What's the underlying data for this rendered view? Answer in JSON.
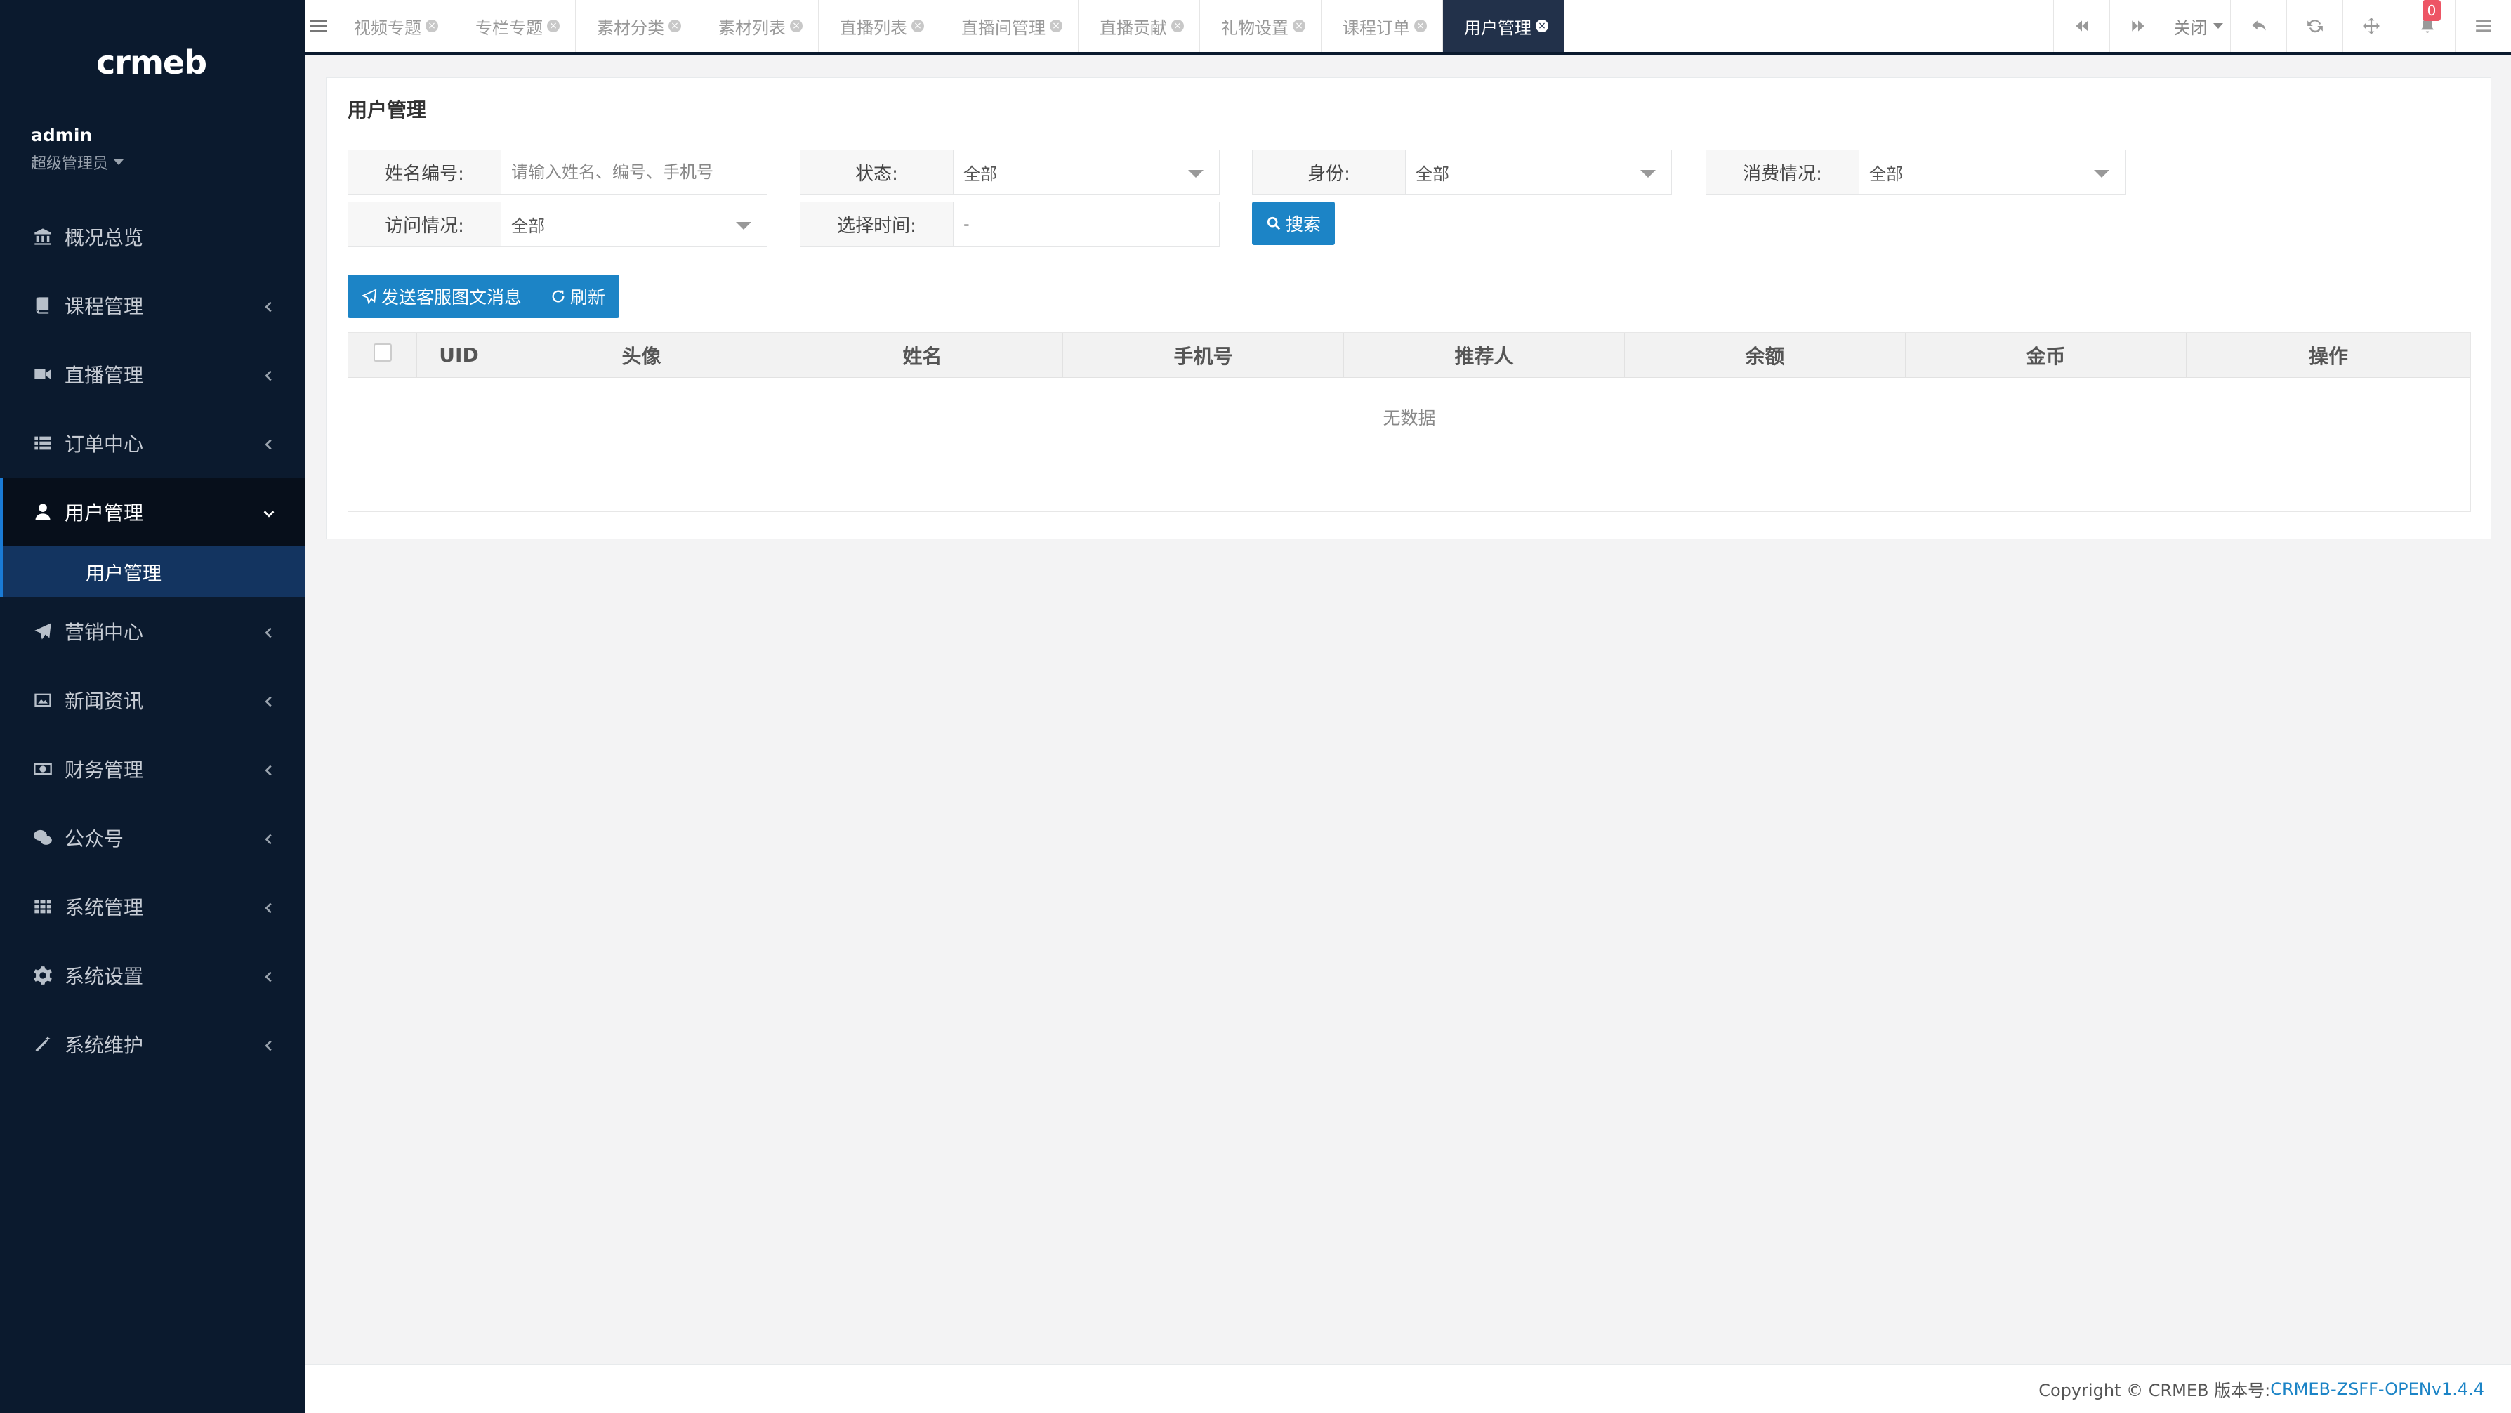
{
  "sidebar": {
    "logo": "crmeb",
    "user": {
      "name": "admin",
      "role": "超级管理员"
    },
    "items": [
      {
        "label": "概况总览",
        "icon": "bank-icon"
      },
      {
        "label": "课程管理",
        "icon": "book-icon"
      },
      {
        "label": "直播管理",
        "icon": "video-camera-icon"
      },
      {
        "label": "订单中心",
        "icon": "list-icon"
      },
      {
        "label": "用户管理",
        "icon": "user-icon",
        "active": true,
        "children": [
          {
            "label": "用户管理"
          }
        ]
      },
      {
        "label": "营销中心",
        "icon": "paper-plane-icon"
      },
      {
        "label": "新闻资讯",
        "icon": "image-icon"
      },
      {
        "label": "财务管理",
        "icon": "money-icon"
      },
      {
        "label": "公众号",
        "icon": "wechat-icon"
      },
      {
        "label": "系统管理",
        "icon": "grid-icon"
      },
      {
        "label": "系统设置",
        "icon": "gear-icon"
      },
      {
        "label": "系统维护",
        "icon": "magic-wand-icon"
      }
    ]
  },
  "topbar": {
    "tabs": [
      {
        "label": "视频专题"
      },
      {
        "label": "专栏专题"
      },
      {
        "label": "素材分类"
      },
      {
        "label": "素材列表"
      },
      {
        "label": "直播列表"
      },
      {
        "label": "直播间管理"
      },
      {
        "label": "直播贡献"
      },
      {
        "label": "礼物设置"
      },
      {
        "label": "课程订单"
      },
      {
        "label": "用户管理",
        "active": true
      }
    ],
    "close_label": "关闭",
    "notification_count": "0"
  },
  "main": {
    "title": "用户管理",
    "filters": {
      "name_label": "姓名编号:",
      "name_placeholder": "请输入姓名、编号、手机号",
      "status_label": "状态:",
      "status_value": "全部",
      "identity_label": "身份:",
      "identity_value": "全部",
      "consumption_label": "消费情况:",
      "consumption_value": "全部",
      "visit_label": "访问情况:",
      "visit_value": "全部",
      "time_label": "选择时间:",
      "time_value": "-",
      "search_label": "搜索"
    },
    "actions": {
      "send_label": "发送客服图文消息",
      "refresh_label": "刷新"
    },
    "table": {
      "columns": [
        "UID",
        "头像",
        "姓名",
        "手机号",
        "推荐人",
        "余额",
        "金币",
        "操作"
      ],
      "empty_text": "无数据"
    }
  },
  "footer": {
    "copyright": "Copyright © CRMEB 版本号:",
    "version": "CRMEB-ZSFF-OPENv1.4.4"
  },
  "colors": {
    "sidebar_bg": "#0b1a2e",
    "submenu_bg": "#133460",
    "primary": "#1c84c6",
    "badge": "#ed5565"
  }
}
